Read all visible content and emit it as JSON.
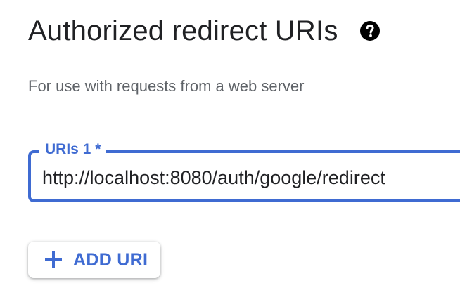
{
  "section": {
    "title": "Authorized redirect URIs",
    "subtitle": "For use with requests from a web server"
  },
  "uri_field": {
    "label": "URIs 1 *",
    "value": "http://localhost:8080/auth/google/redirect"
  },
  "add_button": {
    "label": "ADD URI"
  },
  "icons": {
    "help": "help-circle-icon",
    "add": "plus-icon"
  },
  "colors": {
    "accent": "#3f6bd2",
    "title": "#202124",
    "subtitle": "#5f6368"
  }
}
